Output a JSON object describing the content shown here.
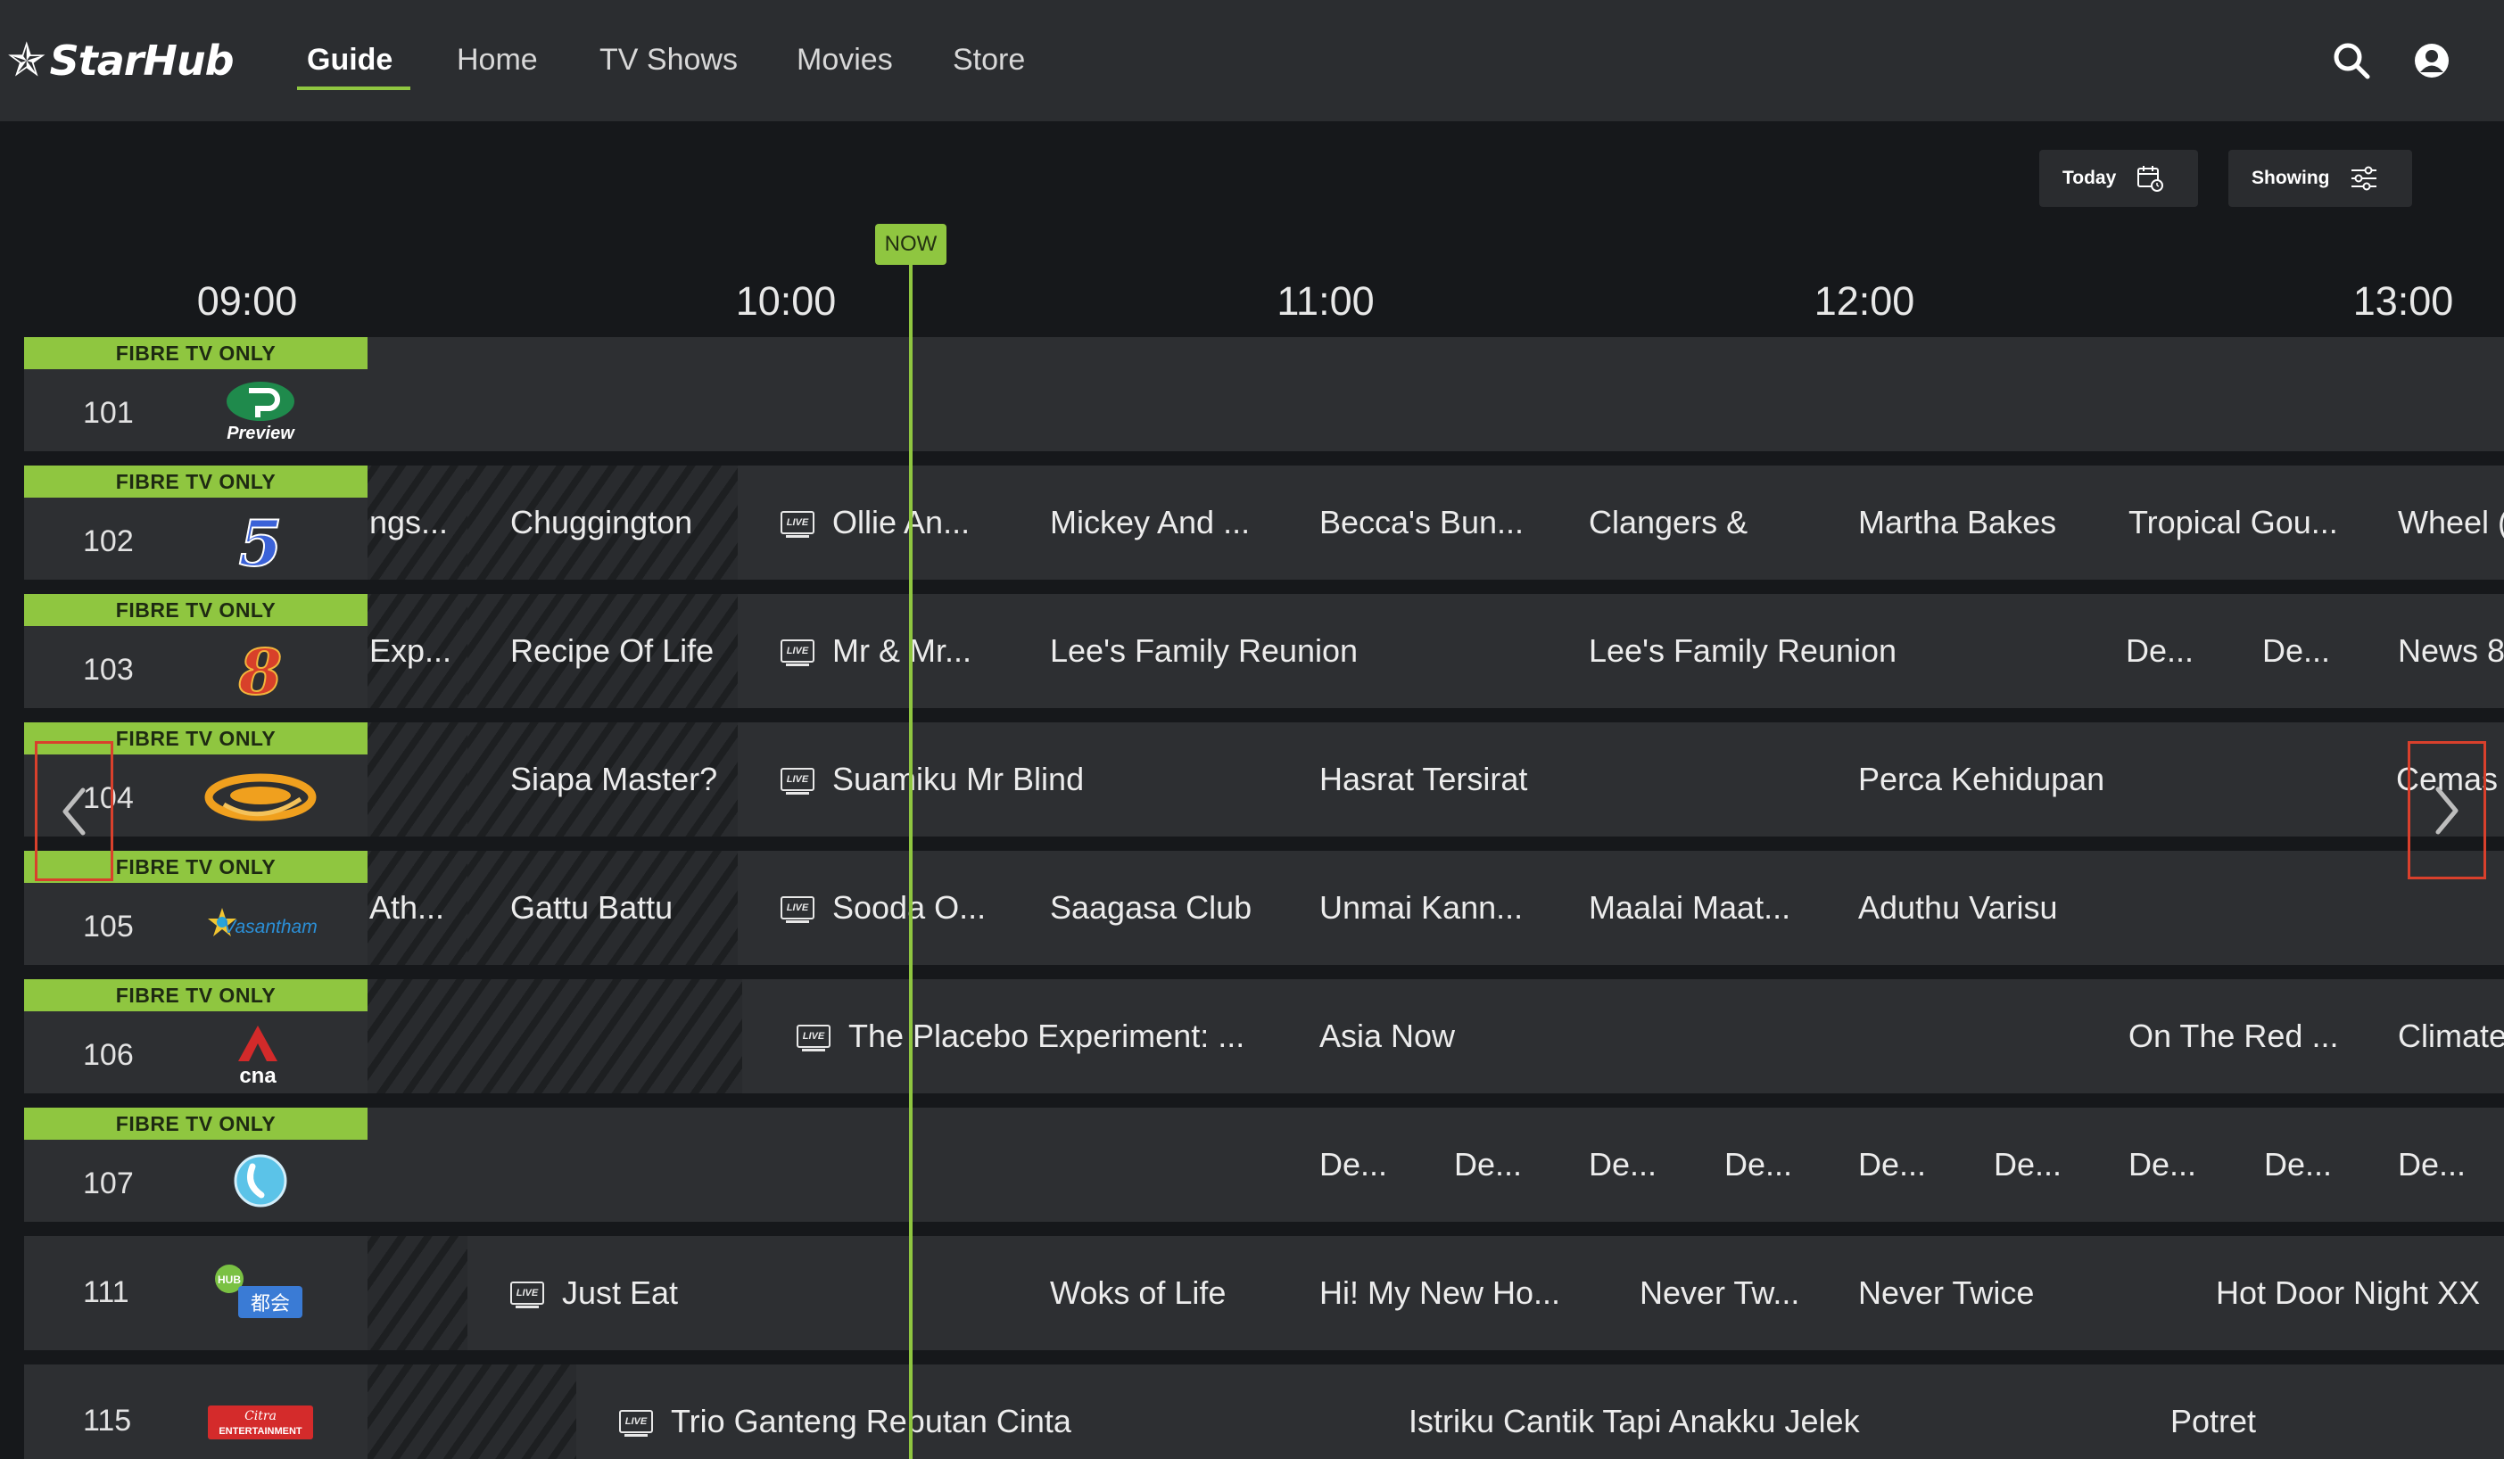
{
  "brand": {
    "name": "StarHub"
  },
  "nav": {
    "items": [
      {
        "label": "Guide",
        "active": true
      },
      {
        "label": "Home",
        "active": false
      },
      {
        "label": "TV Shows",
        "active": false
      },
      {
        "label": "Movies",
        "active": false
      },
      {
        "label": "Store",
        "active": false
      }
    ],
    "icons": [
      "search-icon",
      "account-icon"
    ]
  },
  "controls": {
    "today_label": "Today",
    "showing_label": "Showing"
  },
  "timeline": {
    "slots": [
      "09:00",
      "10:00",
      "11:00",
      "12:00",
      "13:00"
    ],
    "now_label": "NOW"
  },
  "fibre_label": "FIBRE TV ONLY",
  "colors": {
    "accent": "#8fc640",
    "scroll_highlight": "#d9402c",
    "cell": "#2d2f32",
    "topbar": "#2b2d30"
  },
  "channels": [
    {
      "number": "101",
      "fibre": true,
      "logo": "preview-logo",
      "logo_text": "Preview",
      "programs": []
    },
    {
      "number": "102",
      "fibre": true,
      "logo": "channel-5-logo",
      "logo_text": "5",
      "programs": [
        {
          "title": "ngs...",
          "live": false,
          "past": true
        },
        {
          "title": "Chuggington",
          "live": false,
          "past": true
        },
        {
          "title": "Ollie An...",
          "live": true,
          "past": false
        },
        {
          "title": "Mickey And ...",
          "live": false,
          "past": false
        },
        {
          "title": "Becca's Bun...",
          "live": false,
          "past": false
        },
        {
          "title": "Clangers &",
          "live": false,
          "past": false
        },
        {
          "title": "Martha Bakes",
          "live": false,
          "past": false
        },
        {
          "title": "Tropical Gou...",
          "live": false,
          "past": false
        },
        {
          "title": "Wheel (",
          "live": false,
          "past": false
        }
      ]
    },
    {
      "number": "103",
      "fibre": true,
      "logo": "channel-8-logo",
      "logo_text": "8",
      "programs": [
        {
          "title": "Exp...",
          "live": false,
          "past": true
        },
        {
          "title": "Recipe Of Life",
          "live": false,
          "past": true
        },
        {
          "title": "Mr & Mr...",
          "live": true,
          "past": false
        },
        {
          "title": "Lee's Family Reunion",
          "live": false,
          "past": false
        },
        {
          "title": "Lee's Family Reunion",
          "live": false,
          "past": false
        },
        {
          "title": "De...",
          "live": false,
          "past": false
        },
        {
          "title": "De...",
          "live": false,
          "past": false
        },
        {
          "title": "News 8",
          "live": false,
          "past": false
        }
      ]
    },
    {
      "number": "104",
      "fibre": true,
      "logo": "suria-logo",
      "logo_text": "",
      "programs": [
        {
          "title": "",
          "live": false,
          "past": true
        },
        {
          "title": "Siapa Master?",
          "live": false,
          "past": true
        },
        {
          "title": "Suamiku Mr Blind",
          "live": true,
          "past": false
        },
        {
          "title": "Hasrat Tersirat",
          "live": false,
          "past": false
        },
        {
          "title": "Perca Kehidupan",
          "live": false,
          "past": false
        },
        {
          "title": "Cemas",
          "live": false,
          "past": false
        }
      ]
    },
    {
      "number": "105",
      "fibre": true,
      "logo": "vasantham-logo",
      "logo_text": "Vasantham",
      "programs": [
        {
          "title": "Ath...",
          "live": false,
          "past": true
        },
        {
          "title": "Gattu Battu",
          "live": false,
          "past": true
        },
        {
          "title": "Sooda O...",
          "live": true,
          "past": false
        },
        {
          "title": "Saagasa Club",
          "live": false,
          "past": false
        },
        {
          "title": "Unmai Kann...",
          "live": false,
          "past": false
        },
        {
          "title": "Maalai Maat...",
          "live": false,
          "past": false
        },
        {
          "title": "Aduthu Varisu",
          "live": false,
          "past": false
        }
      ]
    },
    {
      "number": "106",
      "fibre": true,
      "logo": "cna-logo",
      "logo_text": "cna",
      "programs": [
        {
          "title": "",
          "live": false,
          "past": true
        },
        {
          "title": "The Placebo Experiment: ...",
          "live": true,
          "past": false
        },
        {
          "title": "Asia Now",
          "live": false,
          "past": false
        },
        {
          "title": "On The Red ...",
          "live": false,
          "past": false
        },
        {
          "title": "Climate",
          "live": false,
          "past": false
        }
      ]
    },
    {
      "number": "107",
      "fibre": true,
      "logo": "channel-u-logo",
      "logo_text": "",
      "programs": [
        {
          "title": "De...",
          "live": false,
          "past": false
        },
        {
          "title": "De...",
          "live": false,
          "past": false
        },
        {
          "title": "De...",
          "live": false,
          "past": false
        },
        {
          "title": "De...",
          "live": false,
          "past": false
        },
        {
          "title": "De...",
          "live": false,
          "past": false
        },
        {
          "title": "De...",
          "live": false,
          "past": false
        },
        {
          "title": "De...",
          "live": false,
          "past": false
        },
        {
          "title": "De...",
          "live": false,
          "past": false
        },
        {
          "title": "De...",
          "live": false,
          "past": false
        }
      ]
    },
    {
      "number": "111",
      "fibre": false,
      "logo": "hub-dushi-logo",
      "logo_text": "HUB 都会",
      "programs": [
        {
          "title": "",
          "live": false,
          "past": true
        },
        {
          "title": "Just Eat",
          "live": true,
          "past": false
        },
        {
          "title": "Woks of Life",
          "live": false,
          "past": false
        },
        {
          "title": "Hi! My New Ho...",
          "live": false,
          "past": false
        },
        {
          "title": "Never Tw...",
          "live": false,
          "past": false
        },
        {
          "title": "Never Twice",
          "live": false,
          "past": false
        },
        {
          "title": "Hot Door Night XX",
          "live": false,
          "past": false
        }
      ]
    },
    {
      "number": "115",
      "fibre": false,
      "logo": "citra-entertainment-logo",
      "logo_text": "Citra ENTERTAINMENT",
      "programs": [
        {
          "title": "",
          "live": false,
          "past": true
        },
        {
          "title": "Trio Ganteng Rebutan Cinta",
          "live": true,
          "past": false
        },
        {
          "title": "Istriku Cantik Tapi Anakku Jelek",
          "live": false,
          "past": false
        },
        {
          "title": "Potret",
          "live": false,
          "past": false
        }
      ]
    }
  ]
}
